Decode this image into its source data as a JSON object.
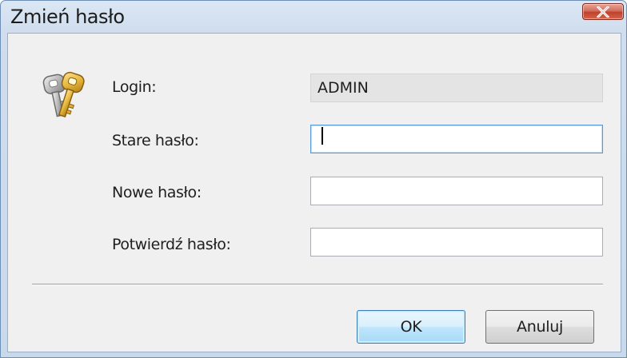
{
  "window": {
    "title": "Zmień hasło"
  },
  "form": {
    "login": {
      "label": "Login:",
      "value": "ADMIN"
    },
    "old_password": {
      "label": "Stare hasło:",
      "value": ""
    },
    "new_password": {
      "label": "Nowe hasło:",
      "value": ""
    },
    "confirm_password": {
      "label": "Potwierdź hasło:",
      "value": ""
    }
  },
  "buttons": {
    "ok_label": "OK",
    "cancel_label": "Anuluj"
  },
  "icons": {
    "dialog_icon": "keys-icon",
    "close_icon": "close-icon"
  },
  "colors": {
    "close_button": "#c0412b",
    "focus_border": "#5b9bd5",
    "readonly_background": "#e4e4e4"
  }
}
